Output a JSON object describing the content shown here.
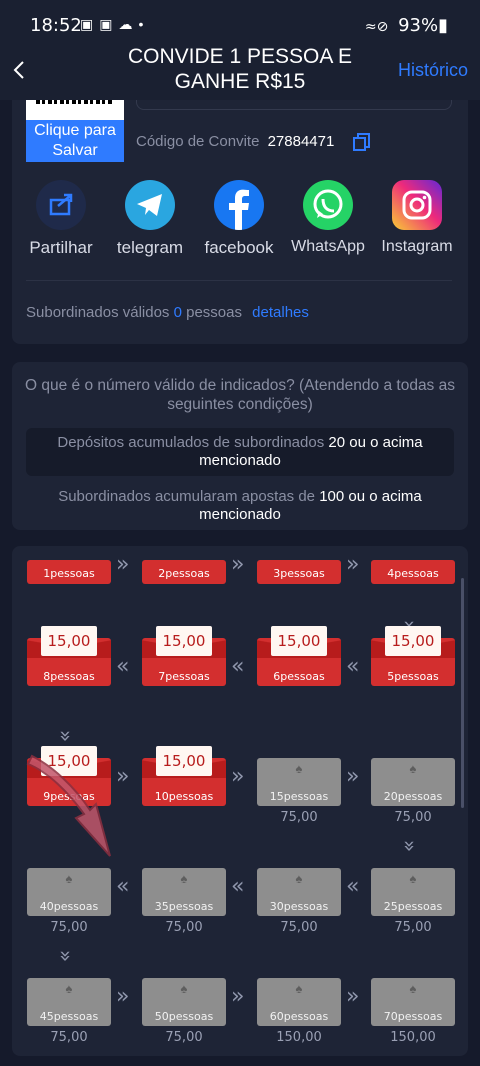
{
  "status_bar": {
    "time": "18:52",
    "battery": "93%"
  },
  "header": {
    "title": "CONVIDE 1 PESSOA E GANHE R$15",
    "history": "Histórico"
  },
  "invite": {
    "save_button": "Clique para Salvar",
    "code_label": "Código de Convite",
    "code": "27884471"
  },
  "share": [
    {
      "label": "Partilhar",
      "icon": "share-icon",
      "color": "#1f2a4a"
    },
    {
      "label": "telegram",
      "icon": "telegram-icon",
      "color": "#2aa6e0"
    },
    {
      "label": "facebook",
      "icon": "facebook-icon",
      "color": "#1877f2"
    },
    {
      "label": "WhatsApp",
      "icon": "whatsapp-icon",
      "color": "#25d366"
    },
    {
      "label": "Instagram",
      "icon": "instagram-icon",
      "color": "#e1306c"
    }
  ],
  "valid": {
    "prefix": "Subordinados válidos",
    "count": "0",
    "suffix": "pessoas",
    "details": "detalhes"
  },
  "conditions": {
    "question": "O que é o número válido de indicados? (Atendendo a todas as seguintes condições)",
    "c1_text": "Depósitos acumulados de subordinados",
    "c1_value": "20 ou o acima mencionado",
    "c2_text": "Subordinados acumularam apostas de",
    "c2_value": "100 ou o acima mencionado"
  },
  "rewards": {
    "row0": [
      "1pessoas",
      "2pessoas",
      "3pessoas",
      "4pessoas"
    ],
    "row1": [
      {
        "label": "8pessoas",
        "amount": "15,00"
      },
      {
        "label": "7pessoas",
        "amount": "15,00"
      },
      {
        "label": "6pessoas",
        "amount": "15,00"
      },
      {
        "label": "5pessoas",
        "amount": "15,00"
      }
    ],
    "row2": [
      {
        "label": "9pessoas",
        "amount": "15,00"
      },
      {
        "label": "10pessoas",
        "amount": "15,00"
      },
      {
        "label": "15pessoas",
        "value": "75,00"
      },
      {
        "label": "20pessoas",
        "value": "75,00"
      }
    ],
    "row3": [
      {
        "label": "40pessoas",
        "value": "75,00"
      },
      {
        "label": "35pessoas",
        "value": "75,00"
      },
      {
        "label": "30pessoas",
        "value": "75,00"
      },
      {
        "label": "25pessoas",
        "value": "75,00"
      }
    ],
    "row4": [
      {
        "label": "45pessoas",
        "value": "75,00"
      },
      {
        "label": "50pessoas",
        "value": "75,00"
      },
      {
        "label": "60pessoas",
        "value": "150,00"
      },
      {
        "label": "70pessoas",
        "value": "150,00"
      }
    ]
  }
}
